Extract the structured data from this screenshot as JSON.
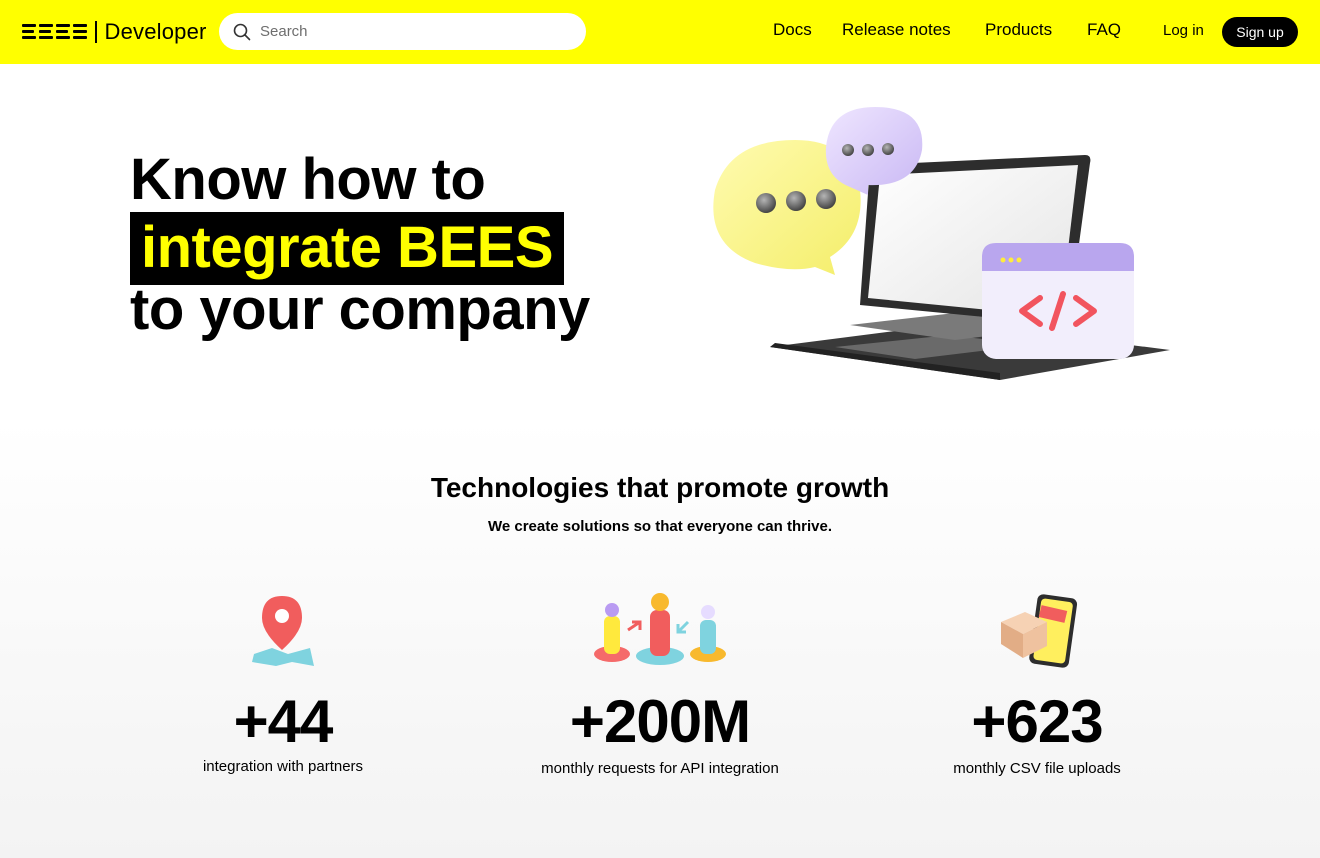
{
  "header": {
    "logo_brand": "BEES",
    "logo_text": "Developer",
    "search_placeholder": "Search",
    "nav": {
      "docs": "Docs",
      "release_notes": "Release notes",
      "products": "Products",
      "faq": "FAQ"
    },
    "login": "Log in",
    "signup": "Sign up",
    "accent_color": "#ffff00"
  },
  "hero": {
    "line1": "Know how to",
    "highlight": "integrate BEES",
    "line3": "to your company",
    "illustration_icon": "laptop-chat-code-icon"
  },
  "growth": {
    "title": "Technologies that promote growth",
    "subtitle": "We create solutions so that everyone can thrive.",
    "stats": [
      {
        "icon": "map-pin-icon",
        "value": "+44",
        "label": "integration with partners"
      },
      {
        "icon": "people-exchange-icon",
        "value": "+200M",
        "label": "monthly requests for API integration"
      },
      {
        "icon": "phone-package-icon",
        "value": "+623",
        "label": "monthly CSV file uploads"
      }
    ]
  }
}
